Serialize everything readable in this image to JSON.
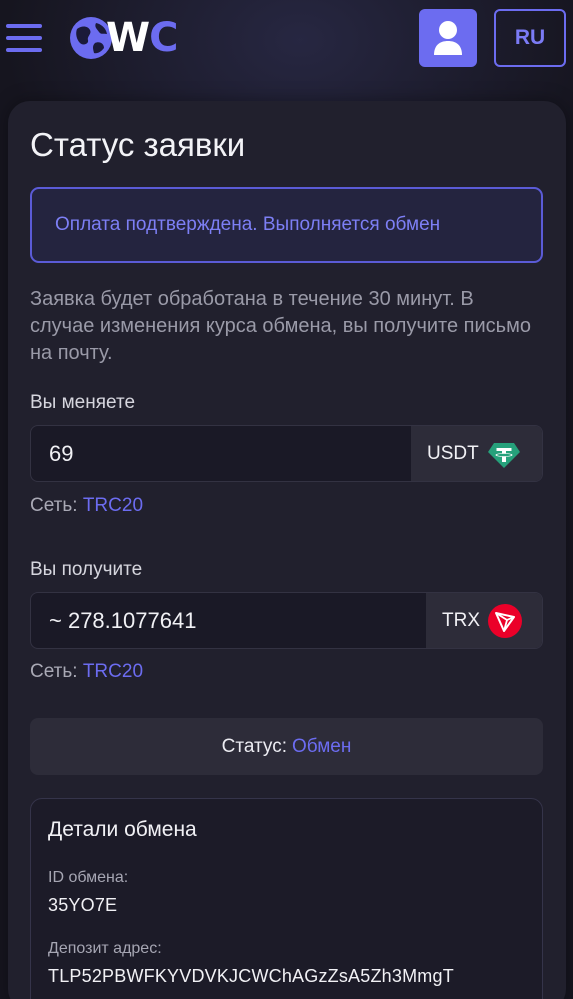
{
  "header": {
    "logo_letters_w": "W",
    "logo_letters_c": "C",
    "language": "RU"
  },
  "status_page": {
    "title": "Статус заявки",
    "alert": "Оплата подтверждена. Выполняется обмен",
    "info": "Заявка будет обработана в течение 30 минут. В случае изменения курса обмена, вы получите письмо на почту.",
    "send": {
      "label": "Вы меняете",
      "amount": "69",
      "currency": "USDT",
      "network_label": "Сеть:",
      "network": "TRC20",
      "icon": "tether-icon",
      "icon_color": "#26A17B"
    },
    "receive": {
      "label": "Вы получите",
      "amount": "~ 278.1077641",
      "currency": "TRX",
      "network_label": "Сеть:",
      "network": "TRC20",
      "icon": "tron-icon",
      "icon_color": "#EB0029"
    },
    "status": {
      "label": "Статус:",
      "value": "Обмен"
    },
    "details": {
      "title": "Детали обмена",
      "id_label": "ID обмена:",
      "id_value": "35YO7E",
      "deposit_label": "Депозит адрес:",
      "deposit_value": "TLP52PBWFKYVDVKJCWChAGzZsA5Zh3MmgT"
    }
  },
  "colors": {
    "accent": "#6C6CF0",
    "background": "#16151F",
    "card": "#21202D"
  }
}
